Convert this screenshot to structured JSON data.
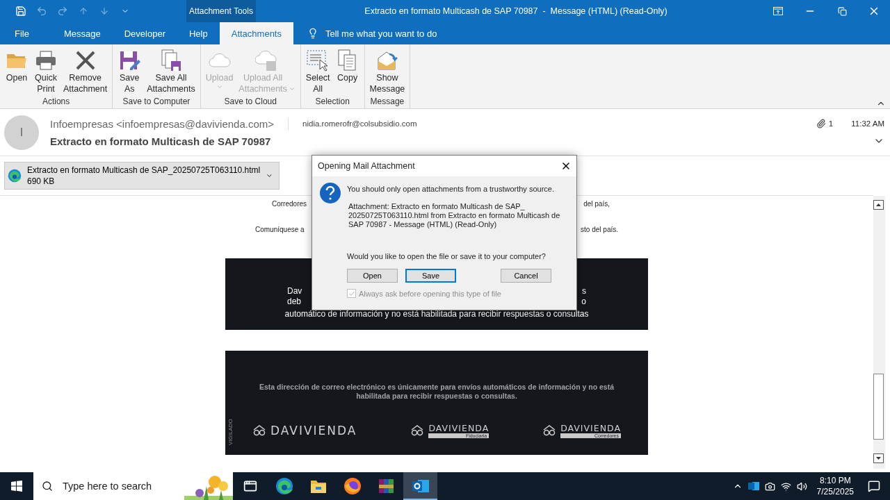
{
  "title_bar": {
    "quick_access": [
      {
        "kind": "save",
        "disabled": false
      },
      {
        "kind": "undo",
        "disabled": true
      },
      {
        "kind": "redo",
        "disabled": true
      },
      {
        "kind": "up",
        "disabled": true
      },
      {
        "kind": "down",
        "disabled": true
      },
      {
        "kind": "customize",
        "disabled": false
      }
    ],
    "context_label": "Attachment Tools",
    "title": "Extracto en formato Multicash de SAP 70987  -  Message (HTML) (Read-Only)"
  },
  "tabs": [
    {
      "label": "File",
      "selected": false
    },
    {
      "label": "Message",
      "selected": false
    },
    {
      "label": "Developer",
      "selected": false
    },
    {
      "label": "Help",
      "selected": false
    },
    {
      "label": "Attachments",
      "selected": true
    }
  ],
  "tell_me": "Tell me what you want to do",
  "ribbon": {
    "groups": [
      {
        "label": "Actions",
        "buttons": [
          {
            "kind": "open",
            "lines": [
              "Open"
            ],
            "disabled": false,
            "dropdown": false
          },
          {
            "kind": "print",
            "lines": [
              "Quick",
              "Print"
            ],
            "disabled": false,
            "dropdown": false
          },
          {
            "kind": "remove",
            "lines": [
              "Remove",
              "Attachment"
            ],
            "disabled": false,
            "dropdown": false
          }
        ]
      },
      {
        "label": "Save to Computer",
        "buttons": [
          {
            "kind": "save_as",
            "lines": [
              "Save",
              "As"
            ],
            "disabled": false,
            "dropdown": false
          },
          {
            "kind": "save_all",
            "lines": [
              "Save All",
              "Attachments"
            ],
            "disabled": false,
            "dropdown": false
          }
        ]
      },
      {
        "label": "Save to Cloud",
        "buttons": [
          {
            "kind": "cloud",
            "lines": [
              "Upload"
            ],
            "disabled": true,
            "dropdown": true
          },
          {
            "kind": "cloud_all",
            "lines": [
              "Upload All",
              "Attachments"
            ],
            "disabled": true,
            "dropdown": true
          }
        ]
      },
      {
        "label": "Selection",
        "buttons": [
          {
            "kind": "select_all",
            "lines": [
              "Select",
              "All"
            ],
            "disabled": false,
            "dropdown": false
          },
          {
            "kind": "copy",
            "lines": [
              "Copy"
            ],
            "disabled": false,
            "dropdown": false
          }
        ]
      },
      {
        "label": "Message",
        "buttons": [
          {
            "kind": "show_message",
            "lines": [
              "Show",
              "Message"
            ],
            "disabled": false,
            "dropdown": false
          }
        ]
      }
    ]
  },
  "header": {
    "avatar": "I",
    "from": "Infoempresas <infoempresas@davivienda.com>",
    "to": "nidia.romerofr@colsubsidio.com",
    "attachment_count": "1",
    "time": "11:32 AM",
    "subject": "Extracto en formato Multicash de SAP 70987"
  },
  "attachment": {
    "name": "Extracto en formato Multicash de SAP_20250725T063110.html",
    "size": "690 KB"
  },
  "body": {
    "lines": [
      {
        "left": "Corredores",
        "right": "del país,"
      },
      {
        "left": "Comuníquese a",
        "right": "sto del país."
      }
    ],
    "banner_1": {
      "lines": [
        {
          "left": "Dav",
          "right": "s"
        },
        {
          "left": "deb",
          "right": "o"
        }
      ],
      "full_line": "automático de información y no está habilitada para recibir respuestas o consultas"
    },
    "banner_2": {
      "side_label": "VIGILADO",
      "notice": "Esta dirección de correo electrónico es únicamente para envíos automáticos de información y no está habilitada para recibir respuestas o consultas.",
      "logos": [
        {
          "name": "DAVIVIENDA"
        },
        {
          "name": "DAVIVIENDA",
          "sub": "Fiduciaria"
        },
        {
          "name": "DAVIVIENDA",
          "sub": "Corredores"
        }
      ]
    }
  },
  "dialog": {
    "title": "Opening Mail Attachment",
    "warning": "You should only open attachments from a trustworthy source.",
    "details": "Attachment: Extracto en formato Multicash de SAP_ 20250725T063110.html from Extracto en formato Multicash de SAP 70987 - Message (HTML) (Read-Only)",
    "question": "Would you like to open the file or save it to your computer?",
    "buttons": [
      {
        "label": "Open",
        "selected": false
      },
      {
        "label": "Save",
        "selected": true
      },
      {
        "label": "Cancel",
        "selected": false
      }
    ],
    "always_ask": {
      "label": "Always ask before opening this type of file",
      "checked": true,
      "disabled": true
    }
  },
  "taskbar": {
    "search_placeholder": "Type here to search",
    "apps": [
      {
        "kind": "task_view",
        "selected": false
      },
      {
        "kind": "edge",
        "selected": false
      },
      {
        "kind": "explorer",
        "selected": false
      },
      {
        "kind": "firefox",
        "selected": false
      },
      {
        "kind": "winrar",
        "selected": false
      },
      {
        "kind": "outlook",
        "selected": true
      }
    ],
    "time": "8:10 PM",
    "date": "7/25/2025"
  }
}
